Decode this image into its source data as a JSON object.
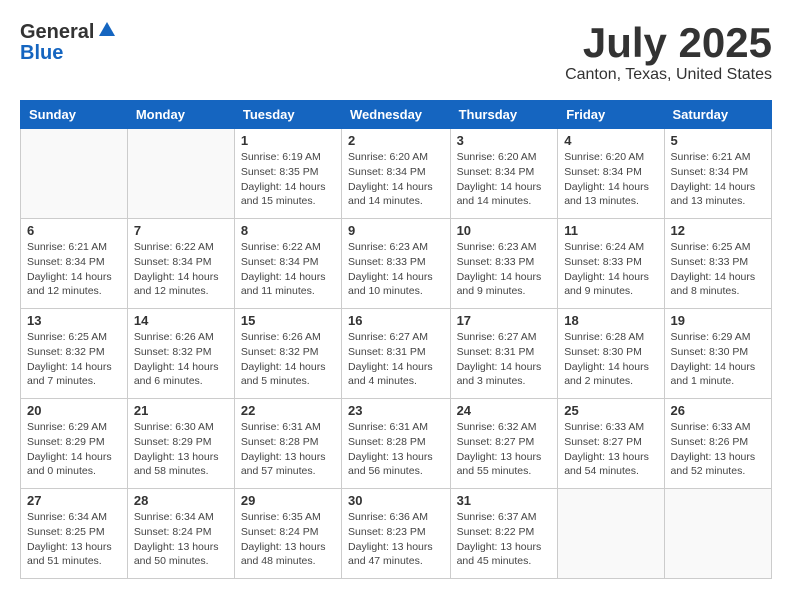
{
  "header": {
    "logo_general": "General",
    "logo_blue": "Blue",
    "title": "July 2025",
    "subtitle": "Canton, Texas, United States"
  },
  "weekdays": [
    "Sunday",
    "Monday",
    "Tuesday",
    "Wednesday",
    "Thursday",
    "Friday",
    "Saturday"
  ],
  "weeks": [
    [
      {
        "day": "",
        "detail": ""
      },
      {
        "day": "",
        "detail": ""
      },
      {
        "day": "1",
        "detail": "Sunrise: 6:19 AM\nSunset: 8:35 PM\nDaylight: 14 hours and 15 minutes."
      },
      {
        "day": "2",
        "detail": "Sunrise: 6:20 AM\nSunset: 8:34 PM\nDaylight: 14 hours and 14 minutes."
      },
      {
        "day": "3",
        "detail": "Sunrise: 6:20 AM\nSunset: 8:34 PM\nDaylight: 14 hours and 14 minutes."
      },
      {
        "day": "4",
        "detail": "Sunrise: 6:20 AM\nSunset: 8:34 PM\nDaylight: 14 hours and 13 minutes."
      },
      {
        "day": "5",
        "detail": "Sunrise: 6:21 AM\nSunset: 8:34 PM\nDaylight: 14 hours and 13 minutes."
      }
    ],
    [
      {
        "day": "6",
        "detail": "Sunrise: 6:21 AM\nSunset: 8:34 PM\nDaylight: 14 hours and 12 minutes."
      },
      {
        "day": "7",
        "detail": "Sunrise: 6:22 AM\nSunset: 8:34 PM\nDaylight: 14 hours and 12 minutes."
      },
      {
        "day": "8",
        "detail": "Sunrise: 6:22 AM\nSunset: 8:34 PM\nDaylight: 14 hours and 11 minutes."
      },
      {
        "day": "9",
        "detail": "Sunrise: 6:23 AM\nSunset: 8:33 PM\nDaylight: 14 hours and 10 minutes."
      },
      {
        "day": "10",
        "detail": "Sunrise: 6:23 AM\nSunset: 8:33 PM\nDaylight: 14 hours and 9 minutes."
      },
      {
        "day": "11",
        "detail": "Sunrise: 6:24 AM\nSunset: 8:33 PM\nDaylight: 14 hours and 9 minutes."
      },
      {
        "day": "12",
        "detail": "Sunrise: 6:25 AM\nSunset: 8:33 PM\nDaylight: 14 hours and 8 minutes."
      }
    ],
    [
      {
        "day": "13",
        "detail": "Sunrise: 6:25 AM\nSunset: 8:32 PM\nDaylight: 14 hours and 7 minutes."
      },
      {
        "day": "14",
        "detail": "Sunrise: 6:26 AM\nSunset: 8:32 PM\nDaylight: 14 hours and 6 minutes."
      },
      {
        "day": "15",
        "detail": "Sunrise: 6:26 AM\nSunset: 8:32 PM\nDaylight: 14 hours and 5 minutes."
      },
      {
        "day": "16",
        "detail": "Sunrise: 6:27 AM\nSunset: 8:31 PM\nDaylight: 14 hours and 4 minutes."
      },
      {
        "day": "17",
        "detail": "Sunrise: 6:27 AM\nSunset: 8:31 PM\nDaylight: 14 hours and 3 minutes."
      },
      {
        "day": "18",
        "detail": "Sunrise: 6:28 AM\nSunset: 8:30 PM\nDaylight: 14 hours and 2 minutes."
      },
      {
        "day": "19",
        "detail": "Sunrise: 6:29 AM\nSunset: 8:30 PM\nDaylight: 14 hours and 1 minute."
      }
    ],
    [
      {
        "day": "20",
        "detail": "Sunrise: 6:29 AM\nSunset: 8:29 PM\nDaylight: 14 hours and 0 minutes."
      },
      {
        "day": "21",
        "detail": "Sunrise: 6:30 AM\nSunset: 8:29 PM\nDaylight: 13 hours and 58 minutes."
      },
      {
        "day": "22",
        "detail": "Sunrise: 6:31 AM\nSunset: 8:28 PM\nDaylight: 13 hours and 57 minutes."
      },
      {
        "day": "23",
        "detail": "Sunrise: 6:31 AM\nSunset: 8:28 PM\nDaylight: 13 hours and 56 minutes."
      },
      {
        "day": "24",
        "detail": "Sunrise: 6:32 AM\nSunset: 8:27 PM\nDaylight: 13 hours and 55 minutes."
      },
      {
        "day": "25",
        "detail": "Sunrise: 6:33 AM\nSunset: 8:27 PM\nDaylight: 13 hours and 54 minutes."
      },
      {
        "day": "26",
        "detail": "Sunrise: 6:33 AM\nSunset: 8:26 PM\nDaylight: 13 hours and 52 minutes."
      }
    ],
    [
      {
        "day": "27",
        "detail": "Sunrise: 6:34 AM\nSunset: 8:25 PM\nDaylight: 13 hours and 51 minutes."
      },
      {
        "day": "28",
        "detail": "Sunrise: 6:34 AM\nSunset: 8:24 PM\nDaylight: 13 hours and 50 minutes."
      },
      {
        "day": "29",
        "detail": "Sunrise: 6:35 AM\nSunset: 8:24 PM\nDaylight: 13 hours and 48 minutes."
      },
      {
        "day": "30",
        "detail": "Sunrise: 6:36 AM\nSunset: 8:23 PM\nDaylight: 13 hours and 47 minutes."
      },
      {
        "day": "31",
        "detail": "Sunrise: 6:37 AM\nSunset: 8:22 PM\nDaylight: 13 hours and 45 minutes."
      },
      {
        "day": "",
        "detail": ""
      },
      {
        "day": "",
        "detail": ""
      }
    ]
  ]
}
